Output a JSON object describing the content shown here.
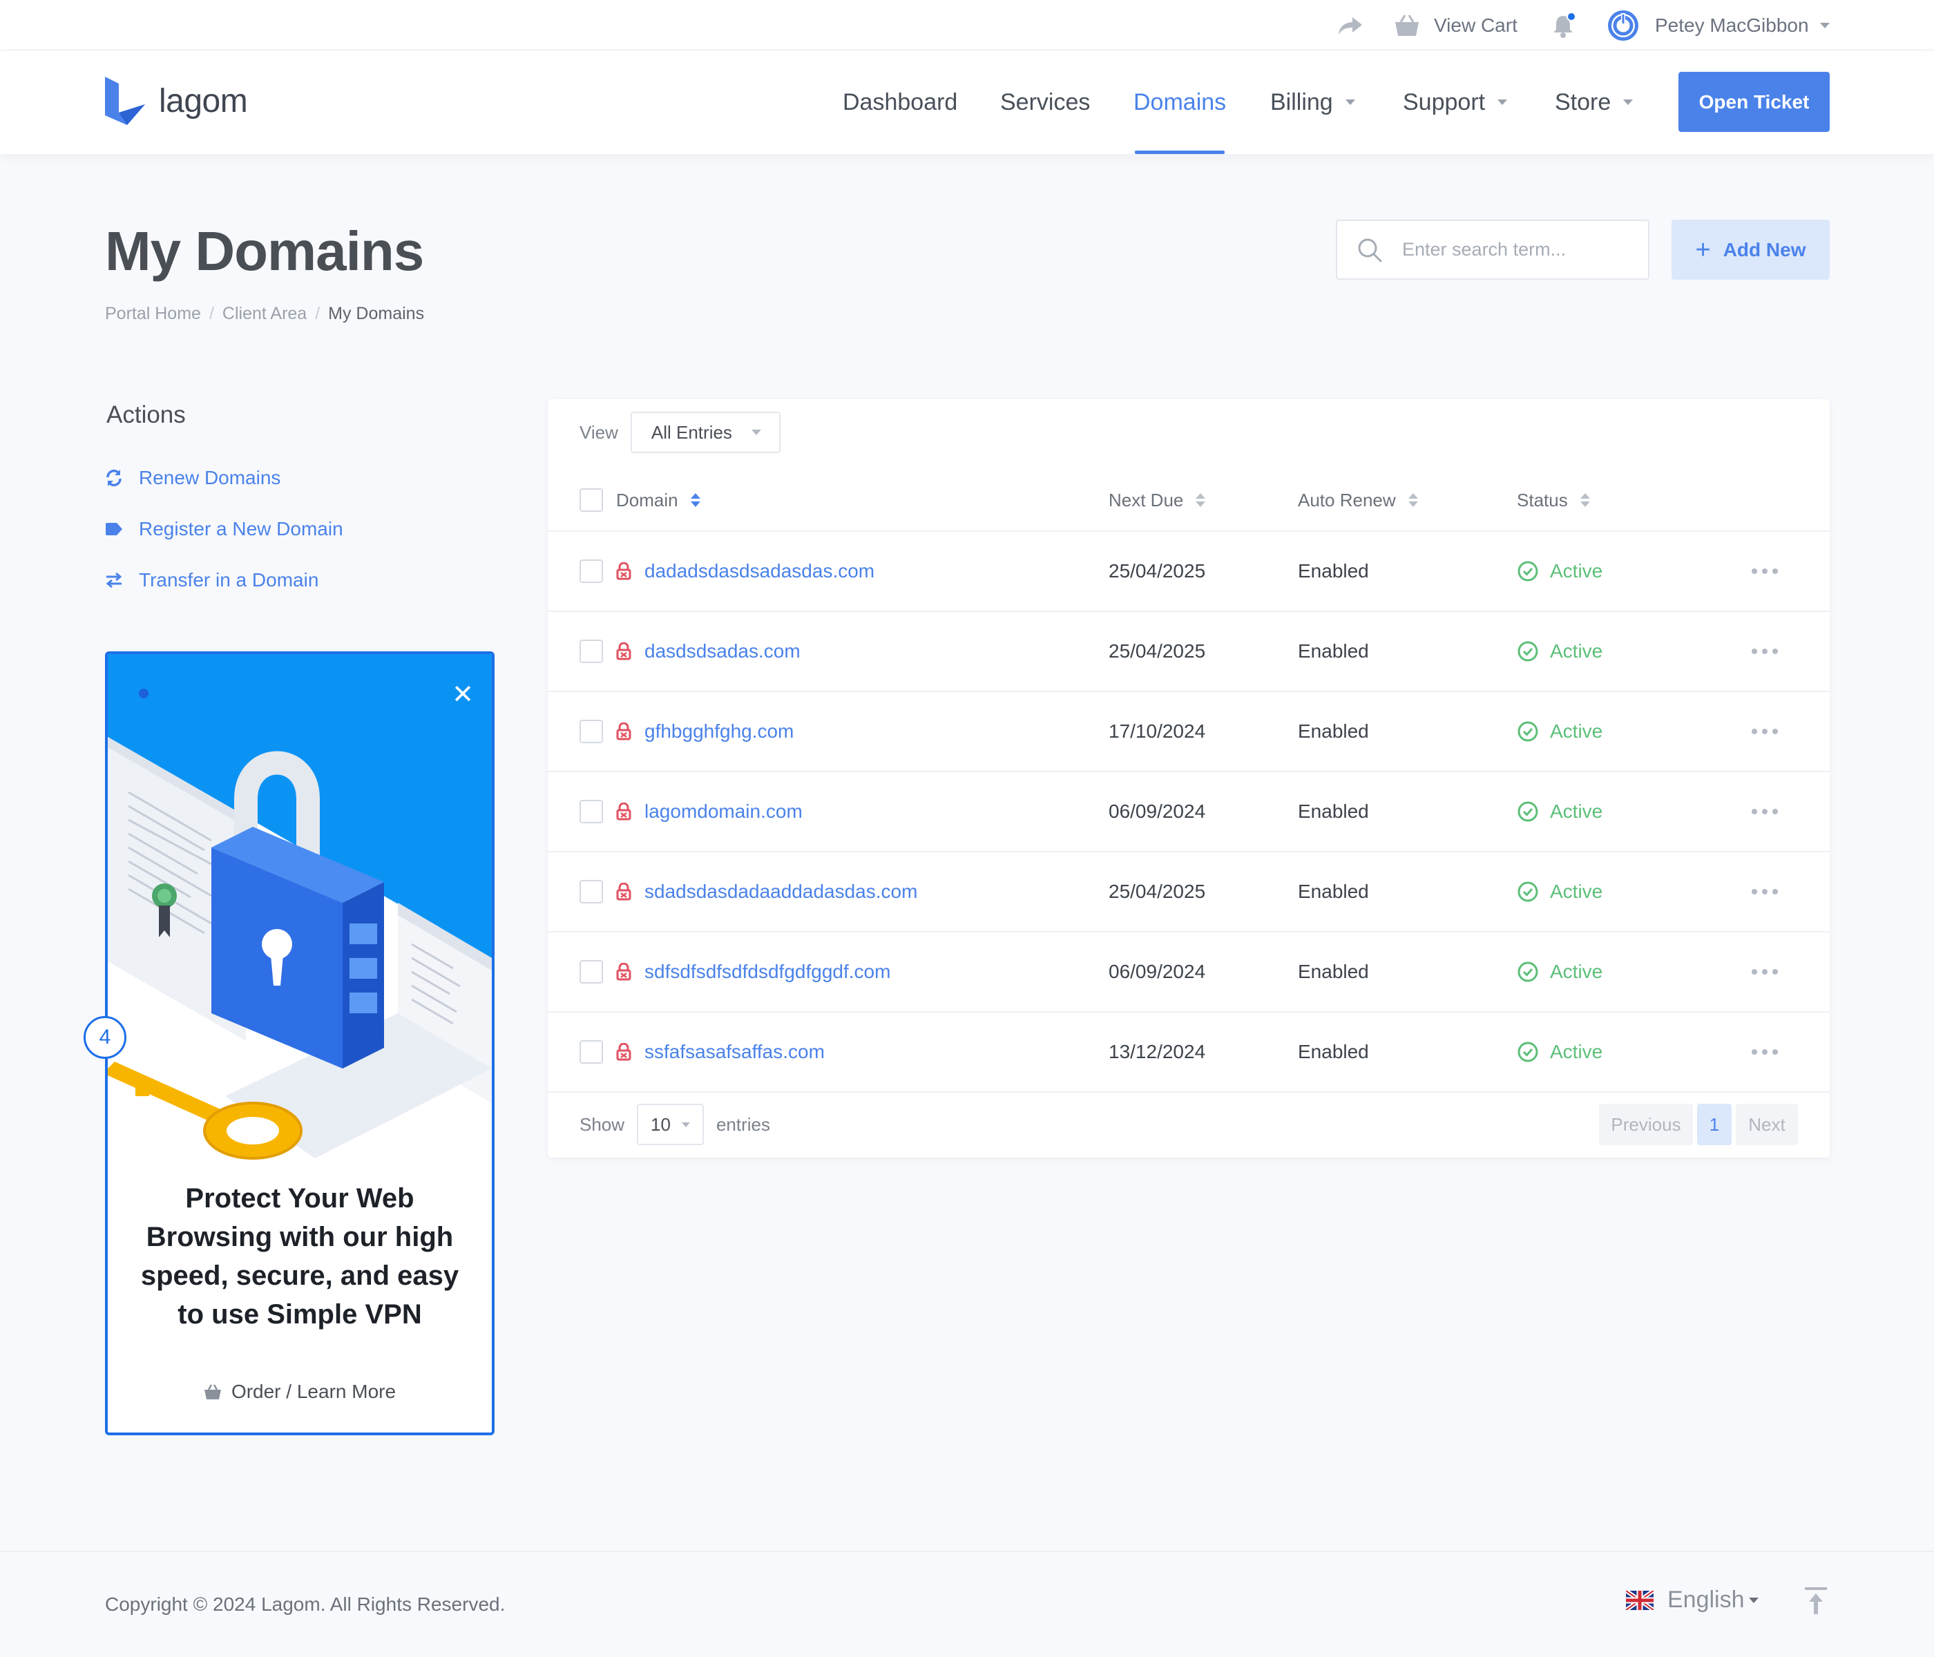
{
  "topbar": {
    "cart_label": "View Cart",
    "user_name": "Petey MacGibbon"
  },
  "brand": {
    "name": "lagom"
  },
  "nav": {
    "items": [
      {
        "label": "Dashboard"
      },
      {
        "label": "Services"
      },
      {
        "label": "Domains",
        "active": true
      },
      {
        "label": "Billing"
      },
      {
        "label": "Support"
      },
      {
        "label": "Store"
      }
    ],
    "cta_label": "Open Ticket"
  },
  "page": {
    "title": "My Domains",
    "breadcrumb": [
      "Portal Home",
      "Client Area",
      "My Domains"
    ],
    "search_placeholder": "Enter search term...",
    "add_new_label": "Add New"
  },
  "sidebar": {
    "title": "Actions",
    "actions": [
      {
        "label": "Renew Domains",
        "icon": "refresh-icon"
      },
      {
        "label": "Register a New Domain",
        "icon": "tag-icon"
      },
      {
        "label": "Transfer in a Domain",
        "icon": "transfer-icon"
      }
    ],
    "promo": {
      "headline": "Protect Your Web Browsing with our high speed, secure, and easy to use Simple VPN",
      "link_label": "Order / Learn More",
      "step": "4"
    }
  },
  "table": {
    "view_label": "View",
    "view_value": "All Entries",
    "columns": [
      "Domain",
      "Next Due",
      "Auto Renew",
      "Status"
    ],
    "rows": [
      {
        "domain": "dadadsdasdsadasdas.com",
        "next_due": "25/04/2025",
        "auto_renew": "Enabled",
        "status": "Active"
      },
      {
        "domain": "dasdsdsadas.com",
        "next_due": "25/04/2025",
        "auto_renew": "Enabled",
        "status": "Active"
      },
      {
        "domain": "gfhbgghfghg.com",
        "next_due": "17/10/2024",
        "auto_renew": "Enabled",
        "status": "Active"
      },
      {
        "domain": "lagomdomain.com",
        "next_due": "06/09/2024",
        "auto_renew": "Enabled",
        "status": "Active"
      },
      {
        "domain": "sdadsdasdadaaddadasdas.com",
        "next_due": "25/04/2025",
        "auto_renew": "Enabled",
        "status": "Active"
      },
      {
        "domain": "sdfsdfsdfsdfdsdfgdfggdf.com",
        "next_due": "06/09/2024",
        "auto_renew": "Enabled",
        "status": "Active"
      },
      {
        "domain": "ssfafsasafsaffas.com",
        "next_due": "13/12/2024",
        "auto_renew": "Enabled",
        "status": "Active"
      }
    ],
    "show_label": "Show",
    "page_size": "10",
    "entries_label": "entries",
    "pager": {
      "prev": "Previous",
      "current": "1",
      "next": "Next"
    }
  },
  "footer": {
    "copyright": "Copyright © 2024 Lagom. All Rights Reserved.",
    "language": "English"
  },
  "colors": {
    "accent": "#4a82ea",
    "success": "#5cbf79",
    "lock": "#e05262",
    "promo_blue": "#1d6fe8"
  }
}
